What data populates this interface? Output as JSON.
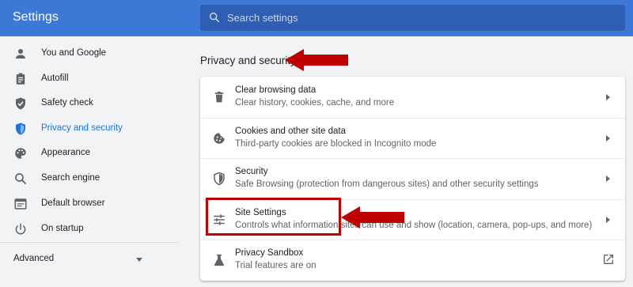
{
  "app": {
    "title": "Settings"
  },
  "search": {
    "placeholder": "Search settings",
    "icon": "search-icon"
  },
  "sidebar": {
    "items": [
      {
        "label": "You and Google",
        "icon": "person-icon",
        "active": false
      },
      {
        "label": "Autofill",
        "icon": "clipboard-icon",
        "active": false
      },
      {
        "label": "Safety check",
        "icon": "shield-check-icon",
        "active": false
      },
      {
        "label": "Privacy and security",
        "icon": "shield-icon",
        "active": true
      },
      {
        "label": "Appearance",
        "icon": "palette-icon",
        "active": false
      },
      {
        "label": "Search engine",
        "icon": "search-icon",
        "active": false
      },
      {
        "label": "Default browser",
        "icon": "browser-icon",
        "active": false
      },
      {
        "label": "On startup",
        "icon": "power-icon",
        "active": false
      }
    ],
    "advanced_label": "Advanced"
  },
  "main": {
    "section_title": "Privacy and security",
    "rows": [
      {
        "title": "Clear browsing data",
        "subtitle": "Clear history, cookies, cache, and more",
        "icon": "trash-icon",
        "action": "chevron-right-icon"
      },
      {
        "title": "Cookies and other site data",
        "subtitle": "Third-party cookies are blocked in Incognito mode",
        "icon": "cookie-icon",
        "action": "chevron-right-icon"
      },
      {
        "title": "Security",
        "subtitle": "Safe Browsing (protection from dangerous sites) and other security settings",
        "icon": "shield-half-icon",
        "action": "chevron-right-icon"
      },
      {
        "title": "Site Settings",
        "subtitle": "Controls what information sites can use and show (location, camera, pop-ups, and more)",
        "icon": "tune-icon",
        "action": "chevron-right-icon"
      },
      {
        "title": "Privacy Sandbox",
        "subtitle": "Trial features are on",
        "icon": "flask-icon",
        "action": "open-in-new-icon"
      }
    ]
  },
  "colors": {
    "header": "#3c78d8",
    "accent": "#1a73e8",
    "annotation": "#c00000"
  }
}
